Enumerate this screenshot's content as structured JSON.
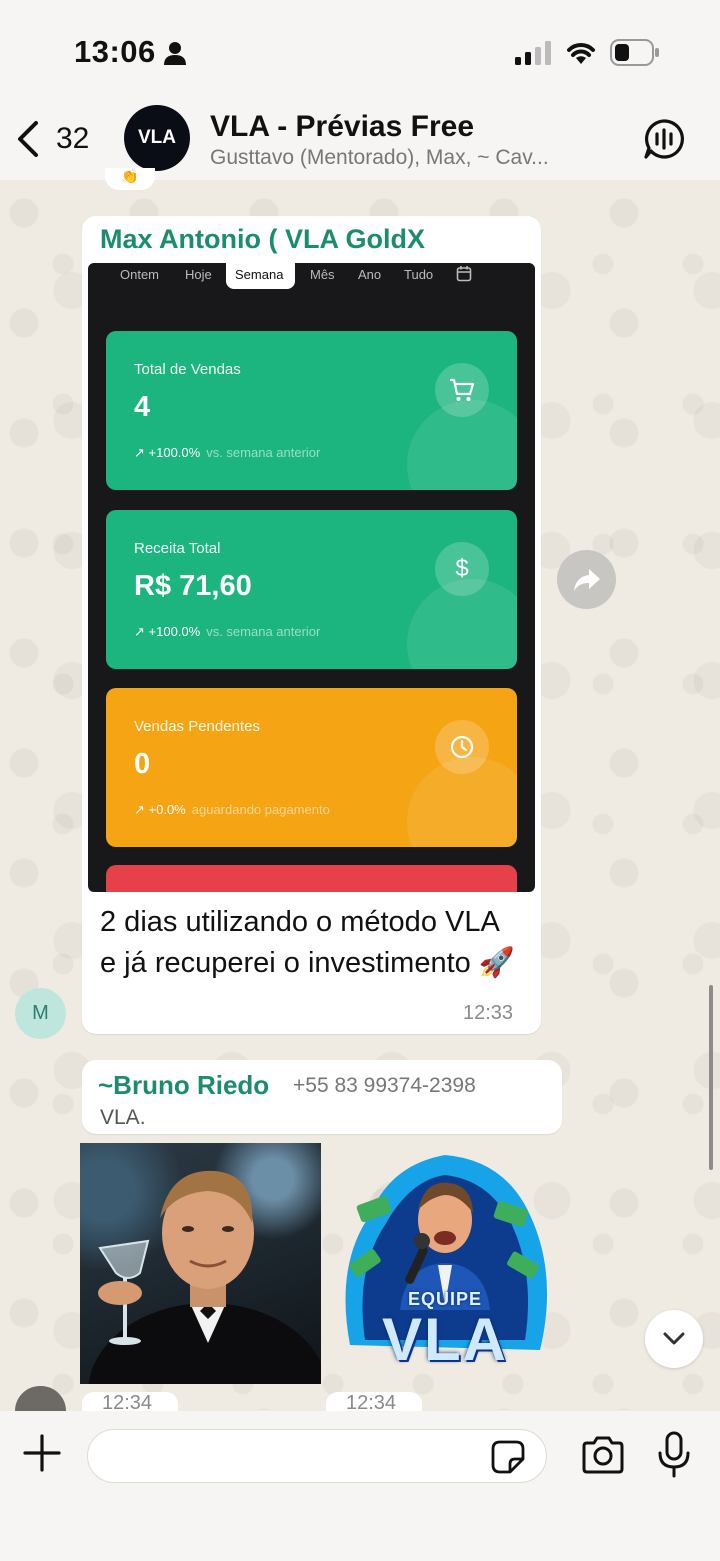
{
  "status_bar": {
    "time": "13:06"
  },
  "header": {
    "back_count": "32",
    "avatar_text": "VLA",
    "title": "VLA - Prévias Free",
    "members": "Gusttavo (Mentorado), Max, ~ Cav..."
  },
  "message1": {
    "sender": "Max Antonio ( VLA GoldX",
    "dashboard": {
      "tabs": [
        "Ontem",
        "Hoje",
        "Semana",
        "Mês",
        "Ano",
        "Tudo"
      ],
      "active_tab": "Semana",
      "cards": [
        {
          "label": "Total de Vendas",
          "value": "4",
          "trend": "+100.0%",
          "note": "vs. semana anterior",
          "icon": "cart-icon",
          "color": "#1cb57f"
        },
        {
          "label": "Receita Total",
          "value": "R$ 71,60",
          "trend": "+100.0%",
          "note": "vs. semana anterior",
          "icon": "dollar-icon",
          "color": "#1cb57f"
        },
        {
          "label": "Vendas Pendentes",
          "value": "0",
          "trend": "+0.0%",
          "note": "aguardando pagamento",
          "icon": "clock-icon",
          "color": "#f5a414"
        }
      ]
    },
    "caption": "2 dias utilizando o método VLA e já recuperei o investimento 🚀",
    "time": "12:33",
    "avatar_letter": "M"
  },
  "message2": {
    "sender": "~Bruno Riedo",
    "phone": "+55 83 99374-2398",
    "text": "VLA.",
    "sticker_text_top": "EQUIPE",
    "sticker_text_main": "VLA",
    "times": [
      "12:34",
      "12:34"
    ]
  },
  "composer": {
    "placeholder": ""
  },
  "colors": {
    "accent": "#1c8c6e",
    "green_card": "#1cb57f",
    "orange_card": "#f5a414",
    "red_card": "#e6404a"
  }
}
